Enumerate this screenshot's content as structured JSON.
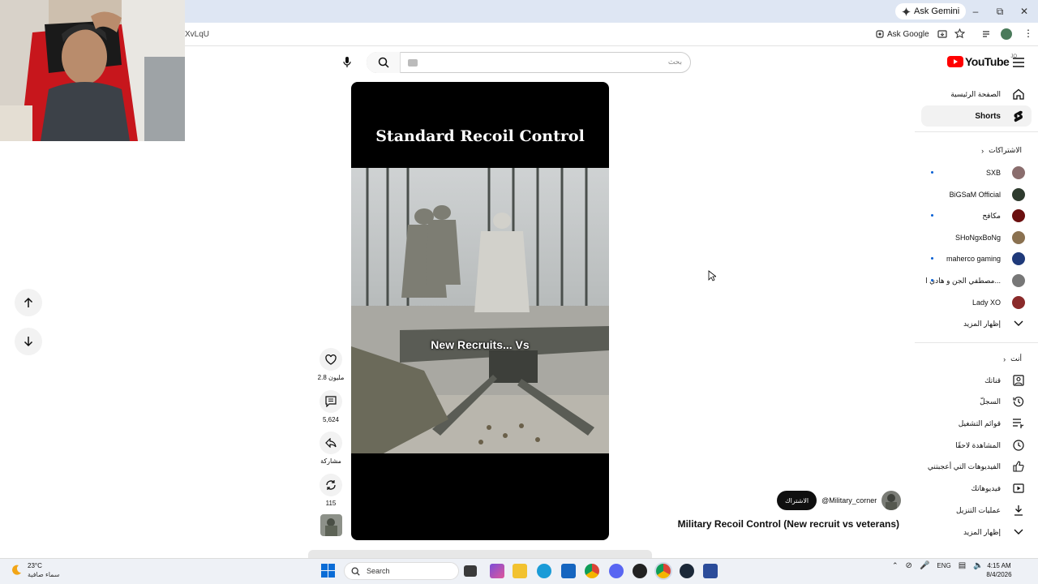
{
  "browser": {
    "ask_gemini": "Ask Gemini",
    "url_fragment": "XvLqU",
    "ask_google": "Ask Google"
  },
  "youtube": {
    "brand": "YouTube",
    "region": "JO",
    "search_placeholder": "بحث"
  },
  "sidebar": {
    "main": [
      {
        "label": "الصفحة الرئيسية",
        "icon": "home-icon"
      },
      {
        "label": "Shorts",
        "icon": "shorts-icon",
        "active": true
      }
    ],
    "subscriptions_header": "الاشتراكات",
    "subscriptions": [
      {
        "label": "SXB",
        "avatar_color": "#8a6d6d",
        "new": true
      },
      {
        "label": "BiGSaM Official",
        "avatar_color": "#2e3b2e",
        "new": false
      },
      {
        "label": "مكافح",
        "avatar_color": "#6b0f0f",
        "new": true
      },
      {
        "label": "SHoNgxBoNg",
        "avatar_color": "#8a7150",
        "new": false
      },
      {
        "label": "maherco gaming",
        "avatar_color": "#1f3a7a",
        "new": true
      },
      {
        "label": "مصطفي الجن و هادي ا...",
        "avatar_color": "#777777",
        "new": true
      },
      {
        "label": "Lady XO",
        "avatar_color": "#8a2a2a",
        "new": false
      }
    ],
    "show_more_1": "إظهار المزيد",
    "you_header": "أنت",
    "you": [
      {
        "label": "قناتك",
        "icon": "channel-icon"
      },
      {
        "label": "السجلّ",
        "icon": "history-icon"
      },
      {
        "label": "قوائم التشغيل",
        "icon": "playlists-icon"
      },
      {
        "label": "المشاهدة لاحقًا",
        "icon": "watch-later-icon"
      },
      {
        "label": "الفيديوهات التي أعجبتني",
        "icon": "liked-icon"
      },
      {
        "label": "فيديوهاتك",
        "icon": "your-videos-icon"
      },
      {
        "label": "عمليات التنزيل",
        "icon": "downloads-icon"
      }
    ],
    "show_more_2": "إظهار المزيد"
  },
  "short": {
    "overlay_title": "Standard Recoil Control",
    "overlay_caption": "New Recruits... Vs",
    "title": "Military Recoil Control (New recruit vs veterans)",
    "channel": "@Military_corner",
    "subscribe_label": "الاشتراك",
    "likes": "2.8 مليون",
    "comments": "5,624",
    "share": "مشاركة",
    "remix": "115"
  },
  "taskbar": {
    "temperature": "23°C",
    "weather": "سماء صافية",
    "search": "Search",
    "language": "ENG",
    "time": "4:15 AM",
    "date": "8/4/2026"
  }
}
